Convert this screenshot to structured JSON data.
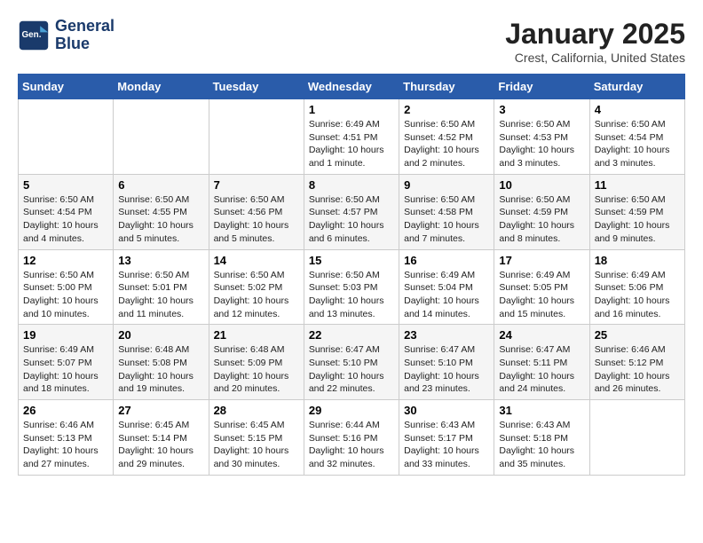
{
  "header": {
    "logo_line1": "General",
    "logo_line2": "Blue",
    "title": "January 2025",
    "subtitle": "Crest, California, United States"
  },
  "days_of_week": [
    "Sunday",
    "Monday",
    "Tuesday",
    "Wednesday",
    "Thursday",
    "Friday",
    "Saturday"
  ],
  "weeks": [
    [
      {
        "day": "",
        "info": ""
      },
      {
        "day": "",
        "info": ""
      },
      {
        "day": "",
        "info": ""
      },
      {
        "day": "1",
        "info": "Sunrise: 6:49 AM\nSunset: 4:51 PM\nDaylight: 10 hours\nand 1 minute."
      },
      {
        "day": "2",
        "info": "Sunrise: 6:50 AM\nSunset: 4:52 PM\nDaylight: 10 hours\nand 2 minutes."
      },
      {
        "day": "3",
        "info": "Sunrise: 6:50 AM\nSunset: 4:53 PM\nDaylight: 10 hours\nand 3 minutes."
      },
      {
        "day": "4",
        "info": "Sunrise: 6:50 AM\nSunset: 4:54 PM\nDaylight: 10 hours\nand 3 minutes."
      }
    ],
    [
      {
        "day": "5",
        "info": "Sunrise: 6:50 AM\nSunset: 4:54 PM\nDaylight: 10 hours\nand 4 minutes."
      },
      {
        "day": "6",
        "info": "Sunrise: 6:50 AM\nSunset: 4:55 PM\nDaylight: 10 hours\nand 5 minutes."
      },
      {
        "day": "7",
        "info": "Sunrise: 6:50 AM\nSunset: 4:56 PM\nDaylight: 10 hours\nand 5 minutes."
      },
      {
        "day": "8",
        "info": "Sunrise: 6:50 AM\nSunset: 4:57 PM\nDaylight: 10 hours\nand 6 minutes."
      },
      {
        "day": "9",
        "info": "Sunrise: 6:50 AM\nSunset: 4:58 PM\nDaylight: 10 hours\nand 7 minutes."
      },
      {
        "day": "10",
        "info": "Sunrise: 6:50 AM\nSunset: 4:59 PM\nDaylight: 10 hours\nand 8 minutes."
      },
      {
        "day": "11",
        "info": "Sunrise: 6:50 AM\nSunset: 4:59 PM\nDaylight: 10 hours\nand 9 minutes."
      }
    ],
    [
      {
        "day": "12",
        "info": "Sunrise: 6:50 AM\nSunset: 5:00 PM\nDaylight: 10 hours\nand 10 minutes."
      },
      {
        "day": "13",
        "info": "Sunrise: 6:50 AM\nSunset: 5:01 PM\nDaylight: 10 hours\nand 11 minutes."
      },
      {
        "day": "14",
        "info": "Sunrise: 6:50 AM\nSunset: 5:02 PM\nDaylight: 10 hours\nand 12 minutes."
      },
      {
        "day": "15",
        "info": "Sunrise: 6:50 AM\nSunset: 5:03 PM\nDaylight: 10 hours\nand 13 minutes."
      },
      {
        "day": "16",
        "info": "Sunrise: 6:49 AM\nSunset: 5:04 PM\nDaylight: 10 hours\nand 14 minutes."
      },
      {
        "day": "17",
        "info": "Sunrise: 6:49 AM\nSunset: 5:05 PM\nDaylight: 10 hours\nand 15 minutes."
      },
      {
        "day": "18",
        "info": "Sunrise: 6:49 AM\nSunset: 5:06 PM\nDaylight: 10 hours\nand 16 minutes."
      }
    ],
    [
      {
        "day": "19",
        "info": "Sunrise: 6:49 AM\nSunset: 5:07 PM\nDaylight: 10 hours\nand 18 minutes."
      },
      {
        "day": "20",
        "info": "Sunrise: 6:48 AM\nSunset: 5:08 PM\nDaylight: 10 hours\nand 19 minutes."
      },
      {
        "day": "21",
        "info": "Sunrise: 6:48 AM\nSunset: 5:09 PM\nDaylight: 10 hours\nand 20 minutes."
      },
      {
        "day": "22",
        "info": "Sunrise: 6:47 AM\nSunset: 5:10 PM\nDaylight: 10 hours\nand 22 minutes."
      },
      {
        "day": "23",
        "info": "Sunrise: 6:47 AM\nSunset: 5:10 PM\nDaylight: 10 hours\nand 23 minutes."
      },
      {
        "day": "24",
        "info": "Sunrise: 6:47 AM\nSunset: 5:11 PM\nDaylight: 10 hours\nand 24 minutes."
      },
      {
        "day": "25",
        "info": "Sunrise: 6:46 AM\nSunset: 5:12 PM\nDaylight: 10 hours\nand 26 minutes."
      }
    ],
    [
      {
        "day": "26",
        "info": "Sunrise: 6:46 AM\nSunset: 5:13 PM\nDaylight: 10 hours\nand 27 minutes."
      },
      {
        "day": "27",
        "info": "Sunrise: 6:45 AM\nSunset: 5:14 PM\nDaylight: 10 hours\nand 29 minutes."
      },
      {
        "day": "28",
        "info": "Sunrise: 6:45 AM\nSunset: 5:15 PM\nDaylight: 10 hours\nand 30 minutes."
      },
      {
        "day": "29",
        "info": "Sunrise: 6:44 AM\nSunset: 5:16 PM\nDaylight: 10 hours\nand 32 minutes."
      },
      {
        "day": "30",
        "info": "Sunrise: 6:43 AM\nSunset: 5:17 PM\nDaylight: 10 hours\nand 33 minutes."
      },
      {
        "day": "31",
        "info": "Sunrise: 6:43 AM\nSunset: 5:18 PM\nDaylight: 10 hours\nand 35 minutes."
      },
      {
        "day": "",
        "info": ""
      }
    ]
  ]
}
